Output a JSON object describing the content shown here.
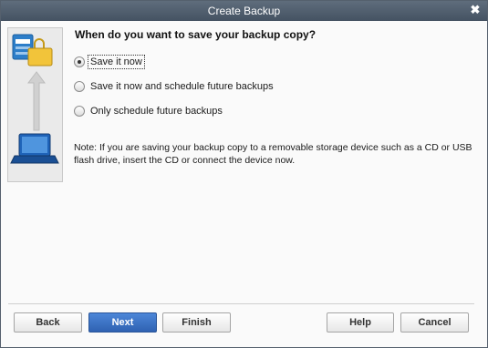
{
  "window": {
    "title": "Create Backup"
  },
  "heading": "When do you want to save your backup copy?",
  "options": [
    {
      "label": "Save it now",
      "checked": true
    },
    {
      "label": "Save it now and schedule future backups",
      "checked": false
    },
    {
      "label": "Only schedule future backups",
      "checked": false
    }
  ],
  "note": "Note: If you are saving your backup copy to a removable storage device such as a CD or USB flash drive, insert the CD or connect the device now.",
  "buttons": {
    "back": "Back",
    "next": "Next",
    "finish": "Finish",
    "help": "Help",
    "cancel": "Cancel"
  },
  "colors": {
    "titlebar": "#4f5d6d",
    "primary_button": "#3a72c4"
  },
  "icons": [
    "close-icon",
    "database-icon",
    "briefcase-icon",
    "up-arrow-icon",
    "laptop-icon"
  ]
}
